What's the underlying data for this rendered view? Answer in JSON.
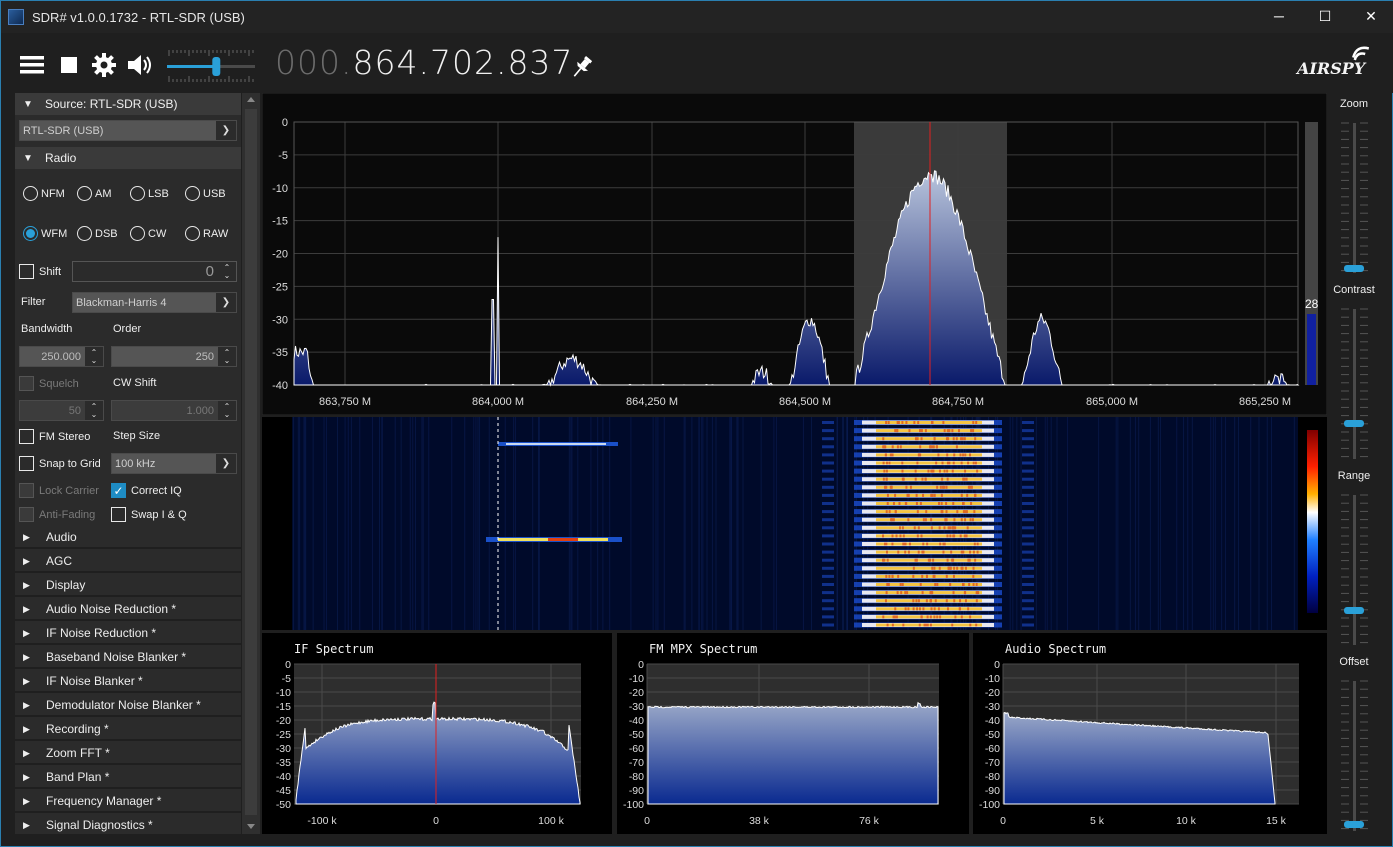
{
  "window": {
    "title": "SDR# v1.0.0.1732 - RTL-SDR (USB)",
    "min_label": "─",
    "max_label": "☐",
    "close_label": "✕"
  },
  "toolbar": {
    "freq_dim": "000.",
    "freq_main": "864.702.837",
    "logo": "AIRSPY",
    "icons": [
      "menu-icon",
      "stop-icon",
      "gear-icon",
      "speaker-icon",
      "pin-icon"
    ],
    "volume_level": 0.55
  },
  "source": {
    "header": "Source: RTL-SDR (USB)",
    "device": "RTL-SDR (USB)"
  },
  "radio": {
    "header": "Radio",
    "modes": [
      "NFM",
      "AM",
      "LSB",
      "USB",
      "WFM",
      "DSB",
      "CW",
      "RAW"
    ],
    "selected_mode": "WFM",
    "shift_label": "Shift",
    "shift_value": "0",
    "filter_label": "Filter",
    "filter_value": "Blackman-Harris 4",
    "bandwidth_label": "Bandwidth",
    "bandwidth_value": "250.000",
    "order_label": "Order",
    "order_value": "250",
    "squelch_label": "Squelch",
    "squelch_value": "50",
    "cwshift_label": "CW Shift",
    "cwshift_value": "1.000",
    "fmstereo_label": "FM Stereo",
    "stepsize_label": "Step Size",
    "snap_label": "Snap to Grid",
    "step_value": "100 kHz",
    "lockcarrier_label": "Lock Carrier",
    "correctiq_label": "Correct IQ",
    "antifading_label": "Anti-Fading",
    "swapiq_label": "Swap I & Q"
  },
  "sections": [
    "Audio",
    "AGC",
    "Display",
    "Audio Noise Reduction *",
    "IF Noise Reduction *",
    "Baseband Noise Blanker *",
    "IF Noise Blanker *",
    "Demodulator Noise Blanker *",
    "Recording *",
    "Zoom FFT *",
    "Band Plan *",
    "Frequency Manager *",
    "Signal Diagnostics *"
  ],
  "right_panel": {
    "zoom": "Zoom",
    "contrast": "Contrast",
    "range": "Range",
    "offset": "Offset"
  },
  "main_spectrum": {
    "y_ticks": [
      "0",
      "-5",
      "-10",
      "-15",
      "-20",
      "-25",
      "-30",
      "-35",
      "-40"
    ],
    "x_ticks": [
      "863,750 M",
      "864,000 M",
      "864,250 M",
      "864,500 M",
      "864,750 M",
      "865,000 M",
      "865,250 M"
    ],
    "level_readout": "28"
  },
  "if_spectrum": {
    "title": "IF Spectrum",
    "y_ticks": [
      "0",
      "-5",
      "-10",
      "-15",
      "-20",
      "-25",
      "-30",
      "-35",
      "-40",
      "-45",
      "-50"
    ],
    "x_ticks": [
      "-100 k",
      "0",
      "100 k"
    ]
  },
  "mpx_spectrum": {
    "title": "FM MPX Spectrum",
    "y_ticks": [
      "0",
      "-10",
      "-20",
      "-30",
      "-40",
      "-50",
      "-60",
      "-70",
      "-80",
      "-90",
      "-100"
    ],
    "x_ticks": [
      "0",
      "38 k",
      "76 k"
    ]
  },
  "audio_spectrum": {
    "title": "Audio Spectrum",
    "y_ticks": [
      "0",
      "-10",
      "-20",
      "-30",
      "-40",
      "-50",
      "-60",
      "-70",
      "-80",
      "-90",
      "-100"
    ],
    "x_ticks": [
      "0",
      "5 k",
      "10 k",
      "15 k"
    ]
  },
  "colors": {
    "accent": "#2aa0d8",
    "marker": "#e02020",
    "spectrum_fill_top": "#a8b8d8",
    "spectrum_fill_bottom": "#0a2a8a"
  }
}
